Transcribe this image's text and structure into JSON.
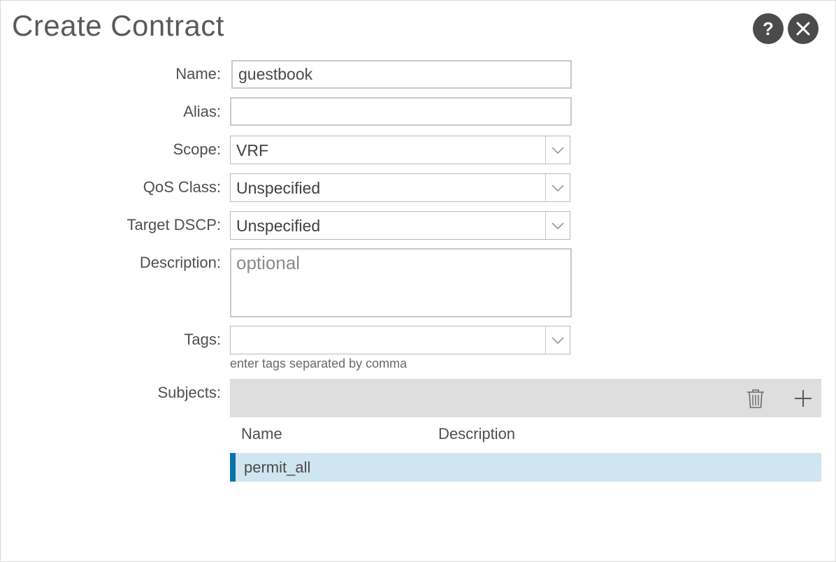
{
  "dialog": {
    "title": "Create Contract",
    "help_icon": "question-mark-icon",
    "close_icon": "close-icon",
    "help_glyph": "?"
  },
  "form": {
    "name": {
      "label": "Name:",
      "value": "guestbook"
    },
    "alias": {
      "label": "Alias:",
      "value": ""
    },
    "scope": {
      "label": "Scope:",
      "value": "VRF"
    },
    "qos_class": {
      "label": "QoS Class:",
      "value": "Unspecified"
    },
    "target_dscp": {
      "label": "Target DSCP:",
      "value": "Unspecified"
    },
    "description": {
      "label": "Description:",
      "placeholder": "optional"
    },
    "tags": {
      "label": "Tags:",
      "value": "",
      "hint": "enter tags separated by comma"
    },
    "subjects": {
      "label": "Subjects:",
      "toolbar_icons": [
        "trash-icon",
        "plus-icon"
      ],
      "columns": [
        "Name",
        "Description"
      ],
      "rows": [
        {
          "name": "permit_all",
          "description": ""
        }
      ]
    }
  },
  "colors": {
    "selected_row": "#cfe5ef",
    "selected_accent": "#0a74a8",
    "toolbar_bg": "#dedede",
    "header_button": "#4b4b4b"
  }
}
